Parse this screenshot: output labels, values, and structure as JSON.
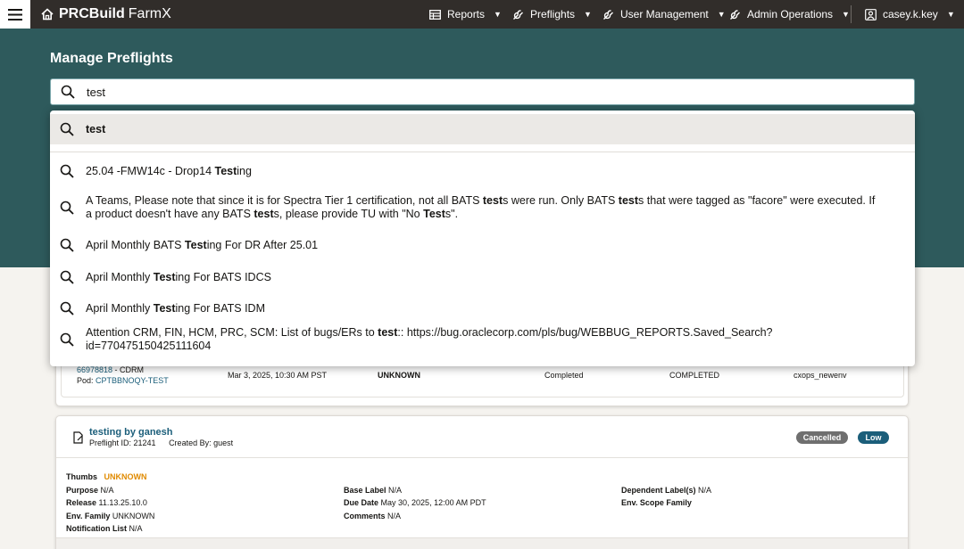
{
  "header": {
    "brand_bold": "PRCBuild",
    "brand_sub": "FarmX",
    "nav": [
      {
        "label": "Reports",
        "icon": "table-icon"
      },
      {
        "label": "Preflights",
        "icon": "wrench-icon"
      },
      {
        "label": "User Management",
        "icon": "wrench-icon"
      },
      {
        "label": "Admin Operations",
        "icon": "wrench-icon"
      }
    ],
    "user": "casey.k.key"
  },
  "page": {
    "title": "Manage Preflights"
  },
  "search": {
    "value": "test",
    "query_suggestion": "test",
    "suggestions": [
      {
        "pre": "25.04 -FMW14c - Drop14 ",
        "bold": "Test",
        "post": "ing"
      },
      {
        "html_parts": [
          {
            "t": "A Teams, Please note that since it is for Spectra Tier 1 certification, not all BATS ",
            "b": false
          },
          {
            "t": "test",
            "b": true
          },
          {
            "t": "s were run. Only BATS ",
            "b": false
          },
          {
            "t": "test",
            "b": true
          },
          {
            "t": "s that were tagged as \"facore\" were executed. If a product doesn't have any BATS ",
            "b": false
          },
          {
            "t": "test",
            "b": true
          },
          {
            "t": "s, please provide TU with \"No ",
            "b": false
          },
          {
            "t": "Test",
            "b": true
          },
          {
            "t": "s\".",
            "b": false
          }
        ]
      },
      {
        "pre": "April Monthly BATS ",
        "bold": "Test",
        "post": "ing For DR After 25.01"
      },
      {
        "pre": "April Monthly ",
        "bold": "Test",
        "post": "ing For BATS IDCS"
      },
      {
        "pre": "April Monthly ",
        "bold": "Test",
        "post": "ing For BATS IDM"
      },
      {
        "pre": "Attention CRM, FIN, HCM, PRC, SCM: List of bugs/ERs to ",
        "bold": "test",
        "post": ":: https://bug.oraclecorp.com/pls/bug/WEBBUG_REPORTS.Saved_Search?id=770475150425111604"
      }
    ]
  },
  "row1": {
    "id": "66978818",
    "id_suffix": " - CDRM",
    "pod_label": "Pod: ",
    "pod": "CPTBBNOQY-TEST",
    "date": "Mar 3, 2025, 10:30 AM PST",
    "thumbs": "UNKNOWN",
    "status": "Completed",
    "state": "COMPLETED",
    "env": "cxops_newenv"
  },
  "card2": {
    "title": "testing by ganesh",
    "preflight_id": "Preflight ID: 21241",
    "created_by": "Created By: guest",
    "badge_status": "Cancelled",
    "badge_priority": "Low",
    "fields": {
      "thumbs_label": "Thumbs",
      "thumbs_value": "UNKNOWN",
      "purpose_label": "Purpose",
      "purpose_value": "N/A",
      "release_label": "Release",
      "release_value": "11.13.25.10.0",
      "env_family_label": "Env. Family",
      "env_family_value": "UNKNOWN",
      "notification_label": "Notification List",
      "notification_value": "N/A",
      "base_label_label": "Base Label",
      "base_label_value": "N/A",
      "due_date_label": "Due Date",
      "due_date_value": "May 30, 2025, 12:00 AM PDT",
      "comments_label": "Comments",
      "comments_value": "N/A",
      "dependent_label": "Dependent Label(s)",
      "dependent_value": "N/A",
      "env_scope_label": "Env. Scope Family"
    }
  },
  "colors": {
    "topbar": "#312d2a",
    "band": "#2e5a5c",
    "link": "#1b5e7a",
    "warning": "#e08a00",
    "badge_cancelled": "#6f6f6f",
    "badge_low": "#1b5e7a"
  }
}
